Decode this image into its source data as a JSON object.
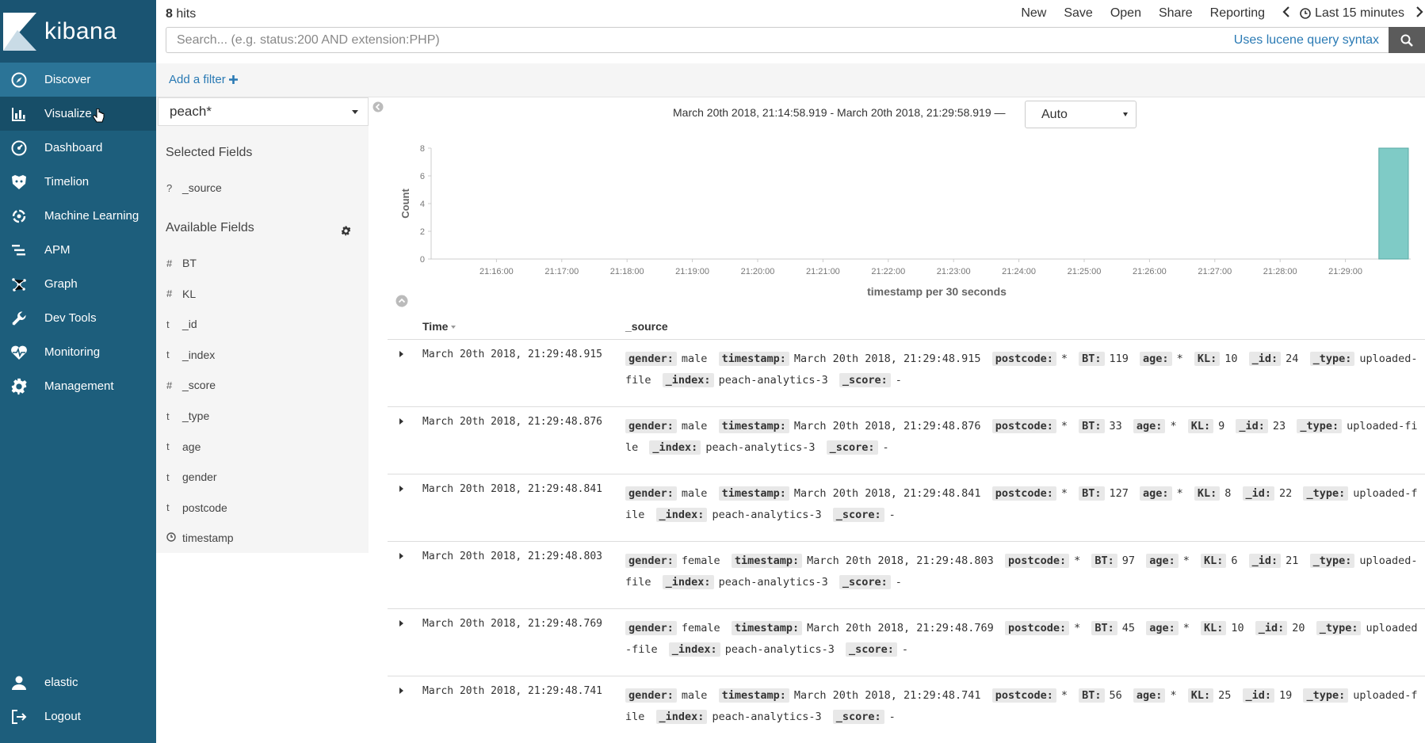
{
  "app": {
    "name": "kibana"
  },
  "sidebar": {
    "items": [
      {
        "label": "Discover",
        "icon": "compass-icon",
        "state": "active"
      },
      {
        "label": "Visualize",
        "icon": "bar-chart-icon",
        "state": "hover"
      },
      {
        "label": "Dashboard",
        "icon": "dashboard-icon",
        "state": ""
      },
      {
        "label": "Timelion",
        "icon": "timelion-icon",
        "state": ""
      },
      {
        "label": "Machine Learning",
        "icon": "ml-icon",
        "state": ""
      },
      {
        "label": "APM",
        "icon": "apm-icon",
        "state": ""
      },
      {
        "label": "Graph",
        "icon": "graph-icon",
        "state": ""
      },
      {
        "label": "Dev Tools",
        "icon": "wrench-icon",
        "state": ""
      },
      {
        "label": "Monitoring",
        "icon": "heartbeat-icon",
        "state": ""
      },
      {
        "label": "Management",
        "icon": "gear-icon",
        "state": ""
      }
    ],
    "user": "elastic",
    "logout": "Logout"
  },
  "topbar": {
    "hits_count": "8",
    "hits_label": " hits",
    "menu": [
      "New",
      "Save",
      "Open",
      "Share",
      "Reporting"
    ],
    "time_label": "Last 15 minutes"
  },
  "search": {
    "placeholder": "Search... (e.g. status:200 AND extension:PHP)",
    "value": "",
    "lucene_link": "Uses lucene query syntax"
  },
  "filter": {
    "add_label": "Add a filter"
  },
  "fields_panel": {
    "index_pattern": "peach*",
    "selected_title": "Selected Fields",
    "selected": [
      {
        "type": "?",
        "name": "_source"
      }
    ],
    "available_title": "Available Fields",
    "available": [
      {
        "type": "#",
        "name": "BT"
      },
      {
        "type": "#",
        "name": "KL"
      },
      {
        "type": "t",
        "name": "_id"
      },
      {
        "type": "t",
        "name": "_index"
      },
      {
        "type": "#",
        "name": "_score"
      },
      {
        "type": "t",
        "name": "_type"
      },
      {
        "type": "t",
        "name": "age"
      },
      {
        "type": "t",
        "name": "gender"
      },
      {
        "type": "t",
        "name": "postcode"
      },
      {
        "type": "clock",
        "name": "timestamp"
      }
    ]
  },
  "histogram": {
    "range_text": "March 20th 2018, 21:14:58.919 - March 20th 2018, 21:29:58.919 —",
    "interval": "Auto"
  },
  "chart_data": {
    "type": "bar",
    "ylabel": "Count",
    "xlabel": "timestamp per 30 seconds",
    "ylim": [
      0,
      8
    ],
    "yticks": [
      0,
      2,
      4,
      6,
      8
    ],
    "xticks": [
      "21:16:00",
      "21:17:00",
      "21:18:00",
      "21:19:00",
      "21:20:00",
      "21:21:00",
      "21:22:00",
      "21:23:00",
      "21:24:00",
      "21:25:00",
      "21:26:00",
      "21:27:00",
      "21:28:00",
      "21:29:00"
    ],
    "x_start": "21:15:00",
    "x_end": "21:30:00",
    "bars": [
      {
        "x": "21:29:30",
        "value": 8
      }
    ],
    "color": "#7fcbc6"
  },
  "table": {
    "col_time": "Time",
    "col_source": "_source",
    "rows": [
      {
        "time": "March 20th 2018, 21:29:48.915",
        "source": [
          [
            "gender:",
            "male"
          ],
          [
            "timestamp:",
            "March 20th 2018, 21:29:48.915"
          ],
          [
            "postcode:",
            "*"
          ],
          [
            "BT:",
            "119"
          ],
          [
            "age:",
            "*"
          ],
          [
            "KL:",
            "10"
          ],
          [
            "_id:",
            "24"
          ],
          [
            "_type:",
            "uploaded-file"
          ],
          [
            "_index:",
            "peach-analytics-3"
          ],
          [
            "_score:",
            "-"
          ]
        ]
      },
      {
        "time": "March 20th 2018, 21:29:48.876",
        "source": [
          [
            "gender:",
            "male"
          ],
          [
            "timestamp:",
            "March 20th 2018, 21:29:48.876"
          ],
          [
            "postcode:",
            "*"
          ],
          [
            "BT:",
            "33"
          ],
          [
            "age:",
            "*"
          ],
          [
            "KL:",
            "9"
          ],
          [
            "_id:",
            "23"
          ],
          [
            "_type:",
            "uploaded-file"
          ],
          [
            "_index:",
            "peach-analytics-3"
          ],
          [
            "_score:",
            "-"
          ]
        ]
      },
      {
        "time": "March 20th 2018, 21:29:48.841",
        "source": [
          [
            "gender:",
            "male"
          ],
          [
            "timestamp:",
            "March 20th 2018, 21:29:48.841"
          ],
          [
            "postcode:",
            "*"
          ],
          [
            "BT:",
            "127"
          ],
          [
            "age:",
            "*"
          ],
          [
            "KL:",
            "8"
          ],
          [
            "_id:",
            "22"
          ],
          [
            "_type:",
            "uploaded-file"
          ],
          [
            "_index:",
            "peach-analytics-3"
          ],
          [
            "_score:",
            "-"
          ]
        ]
      },
      {
        "time": "March 20th 2018, 21:29:48.803",
        "source": [
          [
            "gender:",
            "female"
          ],
          [
            "timestamp:",
            "March 20th 2018, 21:29:48.803"
          ],
          [
            "postcode:",
            "*"
          ],
          [
            "BT:",
            "97"
          ],
          [
            "age:",
            "*"
          ],
          [
            "KL:",
            "6"
          ],
          [
            "_id:",
            "21"
          ],
          [
            "_type:",
            "uploaded-file"
          ],
          [
            "_index:",
            "peach-analytics-3"
          ],
          [
            "_score:",
            "-"
          ]
        ]
      },
      {
        "time": "March 20th 2018, 21:29:48.769",
        "source": [
          [
            "gender:",
            "female"
          ],
          [
            "timestamp:",
            "March 20th 2018, 21:29:48.769"
          ],
          [
            "postcode:",
            "*"
          ],
          [
            "BT:",
            "45"
          ],
          [
            "age:",
            "*"
          ],
          [
            "KL:",
            "10"
          ],
          [
            "_id:",
            "20"
          ],
          [
            "_type:",
            "uploaded-file"
          ],
          [
            "_index:",
            "peach-analytics-3"
          ],
          [
            "_score:",
            "-"
          ]
        ]
      },
      {
        "time": "March 20th 2018, 21:29:48.741",
        "source": [
          [
            "gender:",
            "male"
          ],
          [
            "timestamp:",
            "March 20th 2018, 21:29:48.741"
          ],
          [
            "postcode:",
            "*"
          ],
          [
            "BT:",
            "56"
          ],
          [
            "age:",
            "*"
          ],
          [
            "KL:",
            "25"
          ],
          [
            "_id:",
            "19"
          ],
          [
            "_type:",
            "uploaded-file"
          ],
          [
            "_index:",
            "peach-analytics-3"
          ],
          [
            "_score:",
            "-"
          ]
        ]
      }
    ]
  }
}
